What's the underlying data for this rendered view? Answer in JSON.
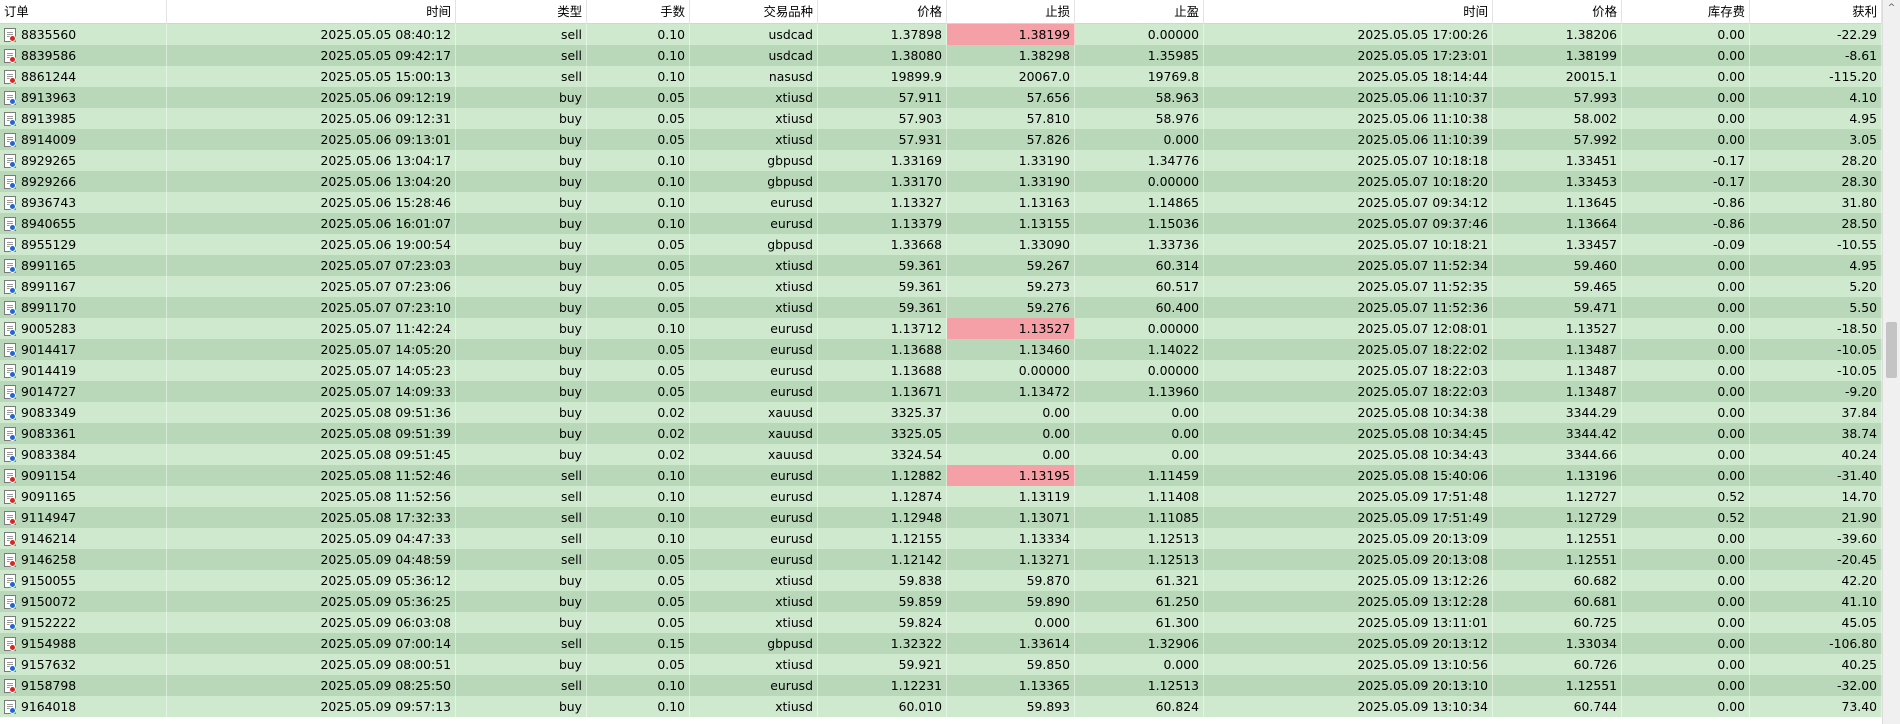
{
  "columns": [
    "订单",
    "时间",
    "类型",
    "手数",
    "交易品种",
    "价格",
    "止损",
    "止盈",
    "时间",
    "价格",
    "库存费",
    "获利"
  ],
  "sort_indicator": "/",
  "scroll_up_arrow": "^",
  "colors": {
    "row_odd": "#cfe9cf",
    "row_even": "#b9d8b9",
    "sl_alert": "#f4a0a6",
    "buy_icon": "#1e66d9",
    "sell_icon": "#d9261e"
  },
  "rows": [
    {
      "order": "8835560",
      "open_time": "2025.05.05 08:40:12",
      "type": "sell",
      "volume": "0.10",
      "symbol": "usdcad",
      "open_price": "1.37898",
      "sl": "1.38199",
      "tp": "0.00000",
      "close_time": "2025.05.05 17:00:26",
      "close_price": "1.38206",
      "swap": "0.00",
      "profit": "-22.29",
      "sl_alert": true
    },
    {
      "order": "8839586",
      "open_time": "2025.05.05 09:42:17",
      "type": "sell",
      "volume": "0.10",
      "symbol": "usdcad",
      "open_price": "1.38080",
      "sl": "1.38298",
      "tp": "1.35985",
      "close_time": "2025.05.05 17:23:01",
      "close_price": "1.38199",
      "swap": "0.00",
      "profit": "-8.61",
      "sl_alert": false
    },
    {
      "order": "8861244",
      "open_time": "2025.05.05 15:00:13",
      "type": "sell",
      "volume": "0.10",
      "symbol": "nasusd",
      "open_price": "19899.9",
      "sl": "20067.0",
      "tp": "19769.8",
      "close_time": "2025.05.05 18:14:44",
      "close_price": "20015.1",
      "swap": "0.00",
      "profit": "-115.20",
      "sl_alert": false
    },
    {
      "order": "8913963",
      "open_time": "2025.05.06 09:12:19",
      "type": "buy",
      "volume": "0.05",
      "symbol": "xtiusd",
      "open_price": "57.911",
      "sl": "57.656",
      "tp": "58.963",
      "close_time": "2025.05.06 11:10:37",
      "close_price": "57.993",
      "swap": "0.00",
      "profit": "4.10",
      "sl_alert": false
    },
    {
      "order": "8913985",
      "open_time": "2025.05.06 09:12:31",
      "type": "buy",
      "volume": "0.05",
      "symbol": "xtiusd",
      "open_price": "57.903",
      "sl": "57.810",
      "tp": "58.976",
      "close_time": "2025.05.06 11:10:38",
      "close_price": "58.002",
      "swap": "0.00",
      "profit": "4.95",
      "sl_alert": false
    },
    {
      "order": "8914009",
      "open_time": "2025.05.06 09:13:01",
      "type": "buy",
      "volume": "0.05",
      "symbol": "xtiusd",
      "open_price": "57.931",
      "sl": "57.826",
      "tp": "0.000",
      "close_time": "2025.05.06 11:10:39",
      "close_price": "57.992",
      "swap": "0.00",
      "profit": "3.05",
      "sl_alert": false
    },
    {
      "order": "8929265",
      "open_time": "2025.05.06 13:04:17",
      "type": "buy",
      "volume": "0.10",
      "symbol": "gbpusd",
      "open_price": "1.33169",
      "sl": "1.33190",
      "tp": "1.34776",
      "close_time": "2025.05.07 10:18:18",
      "close_price": "1.33451",
      "swap": "-0.17",
      "profit": "28.20",
      "sl_alert": false
    },
    {
      "order": "8929266",
      "open_time": "2025.05.06 13:04:20",
      "type": "buy",
      "volume": "0.10",
      "symbol": "gbpusd",
      "open_price": "1.33170",
      "sl": "1.33190",
      "tp": "0.00000",
      "close_time": "2025.05.07 10:18:20",
      "close_price": "1.33453",
      "swap": "-0.17",
      "profit": "28.30",
      "sl_alert": false
    },
    {
      "order": "8936743",
      "open_time": "2025.05.06 15:28:46",
      "type": "buy",
      "volume": "0.10",
      "symbol": "eurusd",
      "open_price": "1.13327",
      "sl": "1.13163",
      "tp": "1.14865",
      "close_time": "2025.05.07 09:34:12",
      "close_price": "1.13645",
      "swap": "-0.86",
      "profit": "31.80",
      "sl_alert": false
    },
    {
      "order": "8940655",
      "open_time": "2025.05.06 16:01:07",
      "type": "buy",
      "volume": "0.10",
      "symbol": "eurusd",
      "open_price": "1.13379",
      "sl": "1.13155",
      "tp": "1.15036",
      "close_time": "2025.05.07 09:37:46",
      "close_price": "1.13664",
      "swap": "-0.86",
      "profit": "28.50",
      "sl_alert": false
    },
    {
      "order": "8955129",
      "open_time": "2025.05.06 19:00:54",
      "type": "buy",
      "volume": "0.05",
      "symbol": "gbpusd",
      "open_price": "1.33668",
      "sl": "1.33090",
      "tp": "1.33736",
      "close_time": "2025.05.07 10:18:21",
      "close_price": "1.33457",
      "swap": "-0.09",
      "profit": "-10.55",
      "sl_alert": false
    },
    {
      "order": "8991165",
      "open_time": "2025.05.07 07:23:03",
      "type": "buy",
      "volume": "0.05",
      "symbol": "xtiusd",
      "open_price": "59.361",
      "sl": "59.267",
      "tp": "60.314",
      "close_time": "2025.05.07 11:52:34",
      "close_price": "59.460",
      "swap": "0.00",
      "profit": "4.95",
      "sl_alert": false
    },
    {
      "order": "8991167",
      "open_time": "2025.05.07 07:23:06",
      "type": "buy",
      "volume": "0.05",
      "symbol": "xtiusd",
      "open_price": "59.361",
      "sl": "59.273",
      "tp": "60.517",
      "close_time": "2025.05.07 11:52:35",
      "close_price": "59.465",
      "swap": "0.00",
      "profit": "5.20",
      "sl_alert": false
    },
    {
      "order": "8991170",
      "open_time": "2025.05.07 07:23:10",
      "type": "buy",
      "volume": "0.05",
      "symbol": "xtiusd",
      "open_price": "59.361",
      "sl": "59.276",
      "tp": "60.400",
      "close_time": "2025.05.07 11:52:36",
      "close_price": "59.471",
      "swap": "0.00",
      "profit": "5.50",
      "sl_alert": false
    },
    {
      "order": "9005283",
      "open_time": "2025.05.07 11:42:24",
      "type": "buy",
      "volume": "0.10",
      "symbol": "eurusd",
      "open_price": "1.13712",
      "sl": "1.13527",
      "tp": "0.00000",
      "close_time": "2025.05.07 12:08:01",
      "close_price": "1.13527",
      "swap": "0.00",
      "profit": "-18.50",
      "sl_alert": true
    },
    {
      "order": "9014417",
      "open_time": "2025.05.07 14:05:20",
      "type": "buy",
      "volume": "0.05",
      "symbol": "eurusd",
      "open_price": "1.13688",
      "sl": "1.13460",
      "tp": "1.14022",
      "close_time": "2025.05.07 18:22:02",
      "close_price": "1.13487",
      "swap": "0.00",
      "profit": "-10.05",
      "sl_alert": false
    },
    {
      "order": "9014419",
      "open_time": "2025.05.07 14:05:23",
      "type": "buy",
      "volume": "0.05",
      "symbol": "eurusd",
      "open_price": "1.13688",
      "sl": "0.00000",
      "tp": "0.00000",
      "close_time": "2025.05.07 18:22:03",
      "close_price": "1.13487",
      "swap": "0.00",
      "profit": "-10.05",
      "sl_alert": false
    },
    {
      "order": "9014727",
      "open_time": "2025.05.07 14:09:33",
      "type": "buy",
      "volume": "0.05",
      "symbol": "eurusd",
      "open_price": "1.13671",
      "sl": "1.13472",
      "tp": "1.13960",
      "close_time": "2025.05.07 18:22:03",
      "close_price": "1.13487",
      "swap": "0.00",
      "profit": "-9.20",
      "sl_alert": false
    },
    {
      "order": "9083349",
      "open_time": "2025.05.08 09:51:36",
      "type": "buy",
      "volume": "0.02",
      "symbol": "xauusd",
      "open_price": "3325.37",
      "sl": "0.00",
      "tp": "0.00",
      "close_time": "2025.05.08 10:34:38",
      "close_price": "3344.29",
      "swap": "0.00",
      "profit": "37.84",
      "sl_alert": false
    },
    {
      "order": "9083361",
      "open_time": "2025.05.08 09:51:39",
      "type": "buy",
      "volume": "0.02",
      "symbol": "xauusd",
      "open_price": "3325.05",
      "sl": "0.00",
      "tp": "0.00",
      "close_time": "2025.05.08 10:34:45",
      "close_price": "3344.42",
      "swap": "0.00",
      "profit": "38.74",
      "sl_alert": false
    },
    {
      "order": "9083384",
      "open_time": "2025.05.08 09:51:45",
      "type": "buy",
      "volume": "0.02",
      "symbol": "xauusd",
      "open_price": "3324.54",
      "sl": "0.00",
      "tp": "0.00",
      "close_time": "2025.05.08 10:34:43",
      "close_price": "3344.66",
      "swap": "0.00",
      "profit": "40.24",
      "sl_alert": false
    },
    {
      "order": "9091154",
      "open_time": "2025.05.08 11:52:46",
      "type": "sell",
      "volume": "0.10",
      "symbol": "eurusd",
      "open_price": "1.12882",
      "sl": "1.13195",
      "tp": "1.11459",
      "close_time": "2025.05.08 15:40:06",
      "close_price": "1.13196",
      "swap": "0.00",
      "profit": "-31.40",
      "sl_alert": true
    },
    {
      "order": "9091165",
      "open_time": "2025.05.08 11:52:56",
      "type": "sell",
      "volume": "0.10",
      "symbol": "eurusd",
      "open_price": "1.12874",
      "sl": "1.13119",
      "tp": "1.11408",
      "close_time": "2025.05.09 17:51:48",
      "close_price": "1.12727",
      "swap": "0.52",
      "profit": "14.70",
      "sl_alert": false
    },
    {
      "order": "9114947",
      "open_time": "2025.05.08 17:32:33",
      "type": "sell",
      "volume": "0.10",
      "symbol": "eurusd",
      "open_price": "1.12948",
      "sl": "1.13071",
      "tp": "1.11085",
      "close_time": "2025.05.09 17:51:49",
      "close_price": "1.12729",
      "swap": "0.52",
      "profit": "21.90",
      "sl_alert": false
    },
    {
      "order": "9146214",
      "open_time": "2025.05.09 04:47:33",
      "type": "sell",
      "volume": "0.10",
      "symbol": "eurusd",
      "open_price": "1.12155",
      "sl": "1.13334",
      "tp": "1.12513",
      "close_time": "2025.05.09 20:13:09",
      "close_price": "1.12551",
      "swap": "0.00",
      "profit": "-39.60",
      "sl_alert": false
    },
    {
      "order": "9146258",
      "open_time": "2025.05.09 04:48:59",
      "type": "sell",
      "volume": "0.05",
      "symbol": "eurusd",
      "open_price": "1.12142",
      "sl": "1.13271",
      "tp": "1.12513",
      "close_time": "2025.05.09 20:13:08",
      "close_price": "1.12551",
      "swap": "0.00",
      "profit": "-20.45",
      "sl_alert": false
    },
    {
      "order": "9150055",
      "open_time": "2025.05.09 05:36:12",
      "type": "buy",
      "volume": "0.05",
      "symbol": "xtiusd",
      "open_price": "59.838",
      "sl": "59.870",
      "tp": "61.321",
      "close_time": "2025.05.09 13:12:26",
      "close_price": "60.682",
      "swap": "0.00",
      "profit": "42.20",
      "sl_alert": false
    },
    {
      "order": "9150072",
      "open_time": "2025.05.09 05:36:25",
      "type": "buy",
      "volume": "0.05",
      "symbol": "xtiusd",
      "open_price": "59.859",
      "sl": "59.890",
      "tp": "61.250",
      "close_time": "2025.05.09 13:12:28",
      "close_price": "60.681",
      "swap": "0.00",
      "profit": "41.10",
      "sl_alert": false
    },
    {
      "order": "9152222",
      "open_time": "2025.05.09 06:03:08",
      "type": "buy",
      "volume": "0.05",
      "symbol": "xtiusd",
      "open_price": "59.824",
      "sl": "0.000",
      "tp": "61.300",
      "close_time": "2025.05.09 13:11:01",
      "close_price": "60.725",
      "swap": "0.00",
      "profit": "45.05",
      "sl_alert": false
    },
    {
      "order": "9154988",
      "open_time": "2025.05.09 07:00:14",
      "type": "sell",
      "volume": "0.15",
      "symbol": "gbpusd",
      "open_price": "1.32322",
      "sl": "1.33614",
      "tp": "1.32906",
      "close_time": "2025.05.09 20:13:12",
      "close_price": "1.33034",
      "swap": "0.00",
      "profit": "-106.80",
      "sl_alert": false
    },
    {
      "order": "9157632",
      "open_time": "2025.05.09 08:00:51",
      "type": "buy",
      "volume": "0.05",
      "symbol": "xtiusd",
      "open_price": "59.921",
      "sl": "59.850",
      "tp": "0.000",
      "close_time": "2025.05.09 13:10:56",
      "close_price": "60.726",
      "swap": "0.00",
      "profit": "40.25",
      "sl_alert": false
    },
    {
      "order": "9158798",
      "open_time": "2025.05.09 08:25:50",
      "type": "sell",
      "volume": "0.10",
      "symbol": "eurusd",
      "open_price": "1.12231",
      "sl": "1.13365",
      "tp": "1.12513",
      "close_time": "2025.05.09 20:13:10",
      "close_price": "1.12551",
      "swap": "0.00",
      "profit": "-32.00",
      "sl_alert": false
    },
    {
      "order": "9164018",
      "open_time": "2025.05.09 09:57:13",
      "type": "buy",
      "volume": "0.10",
      "symbol": "xtiusd",
      "open_price": "60.010",
      "sl": "59.893",
      "tp": "60.824",
      "close_time": "2025.05.09 13:10:34",
      "close_price": "60.744",
      "swap": "0.00",
      "profit": "73.40",
      "sl_alert": false
    }
  ]
}
